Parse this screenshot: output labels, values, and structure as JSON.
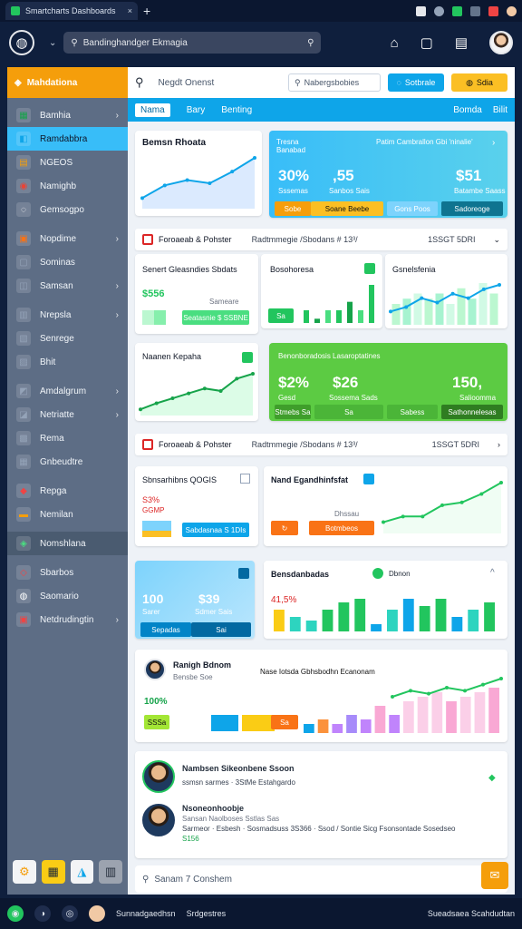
{
  "browser": {
    "tab_title": "Smartcharts Dashboards",
    "tab_close": "×",
    "new_tab": "+"
  },
  "app": {
    "logo_glyph": "◍",
    "search_placeholder": "Bandinghandger Ekmagia",
    "top_icons": [
      "home-icon",
      "square-icon",
      "calendar-icon"
    ]
  },
  "sidebar": {
    "header": "Mahdationa",
    "items": [
      {
        "label": "Bamhia",
        "icon": "▦",
        "color": "#16a34a",
        "chevron": true
      },
      {
        "label": "Ramdabbra",
        "icon": "◧",
        "color": "#0ea5e9",
        "active": true
      },
      {
        "label": "NGEOS",
        "icon": "▤",
        "color": "#f59e0b"
      },
      {
        "label": "Namighb",
        "icon": "◉",
        "color": "#ea4335"
      },
      {
        "label": "Gemsogpo",
        "icon": "◌",
        "color": "#ffffff"
      },
      {
        "label": "Nopdime",
        "icon": "▣",
        "color": "#f97316",
        "chevron": true
      },
      {
        "label": "Sominas",
        "icon": "▢",
        "color": "#94a3b8"
      },
      {
        "label": "Samsan",
        "icon": "◫",
        "color": "#94a3b8",
        "chevron": true
      },
      {
        "label": "Nrepsla",
        "icon": "▥",
        "color": "#94a3b8",
        "chevron": true
      },
      {
        "label": "Senrege",
        "icon": "▧",
        "color": "#94a3b8"
      },
      {
        "label": "Bhit",
        "icon": "▨",
        "color": "#94a3b8"
      },
      {
        "label": "Amdalgrum",
        "icon": "◩",
        "color": "#94a3b8",
        "chevron": true
      },
      {
        "label": "Netriatte",
        "icon": "◪",
        "color": "#94a3b8",
        "chevron": true
      },
      {
        "label": "Rema",
        "icon": "▩",
        "color": "#94a3b8"
      },
      {
        "label": "Gnbeudtre",
        "icon": "▦",
        "color": "#94a3b8"
      },
      {
        "label": "Repga",
        "icon": "◆",
        "color": "#ef4444"
      },
      {
        "label": "Nemilan",
        "icon": "▬",
        "color": "#f59e0b"
      },
      {
        "label": "Nomshlana",
        "icon": "◈",
        "color": "#4ade80",
        "active2": true
      },
      {
        "label": "Sbarbos",
        "icon": "◇",
        "color": "#ef4444"
      },
      {
        "label": "Saomario",
        "icon": "◍",
        "color": "#ffffff"
      },
      {
        "label": "Netdrudingtin",
        "icon": "▣",
        "color": "#ef4444",
        "chevron": true
      }
    ],
    "bottom_buttons": [
      "⚙",
      "▦",
      "◮",
      "▥"
    ]
  },
  "main": {
    "topbar_label": "Negdt Onenst",
    "search_placeholder": "Nabergsbobies",
    "btn_blue": "Sotbrale",
    "btn_orange": "Sdia",
    "tabs": [
      "Nama",
      "Bary",
      "Benting"
    ],
    "tabs_right": [
      "Bomda",
      "Bilit"
    ]
  },
  "cards": {
    "revenue": {
      "title": "Bemsn Rhoata"
    },
    "blue_stats": {
      "label_left": "Tresna Banabad",
      "label_right": "Patim Cambrallon Gbi 'ninalie'",
      "v1": "30%",
      "v1_sub": "Sssemas",
      "v2": ",55",
      "v2_sub": "Sanbos  Sais",
      "v3": "$51",
      "v3_sub": "Batambe Saass",
      "pill1": "Sobe",
      "pill2": "Soane Beebe",
      "pill3": "Gons Poos",
      "pill4": "Sadoreoge"
    },
    "section1": {
      "title": "Foroaeab & Pohster",
      "mid": "Radtmmegie /Sbodans # 13³/",
      "date": "1SSGT 5DRI"
    },
    "sales": {
      "title": "Senert Gleasndies Sbdats",
      "value": "$556",
      "sub": "Sameare",
      "button": "Seatasnie $ SSBNE"
    },
    "goodhousa": {
      "title": "Bosohoresa",
      "button": "Sa"
    },
    "generalia": {
      "title": "Gsnelsfenia"
    },
    "kanaka": {
      "title": "Naanen Kepaha"
    },
    "green_stats": {
      "title": "Benonboradosis  Lasaroptatines",
      "v1": "$2%",
      "v1_sub": "Gesd",
      "v2": "$26",
      "v2_sub": "Sossema Sads",
      "v3": "150,",
      "v3_sub": "Salioomma",
      "pill1": "Stmebs Sa",
      "pill2": "Sa",
      "pill3": "Sabess",
      "pill4": "Sathonnelesas"
    },
    "section2": {
      "title": "Foroaeab & Pohster",
      "mid": "Radtmmegie /Sbodans # 13³/",
      "date": "1SSGT 5DRI"
    },
    "conv": {
      "title": "Sbnsarhibns QOGIS",
      "value": "S3%",
      "sub": "GGMP",
      "button": "Sabdasnaa S 1DIs"
    },
    "engagement": {
      "title": "Nand Egandhinfsfat",
      "sub": "Dhssau",
      "button1": " ",
      "button2": "Botmbeos"
    },
    "lightblue": {
      "v1": "100",
      "v1_sub": "Sarer",
      "v2": "$39",
      "v2_sub": "Sdmer Sais",
      "pill1": "Sepadas",
      "pill2": "Sai"
    },
    "breakdown": {
      "title": "Bensdanbadas",
      "badge": "Dbnon",
      "value": "41,5%"
    },
    "team": {
      "title": "Ranigh Bdnom",
      "sub": "Bensbe Soe",
      "right_title": "Nase Iotsda Gbhsbodhn Ecanonam",
      "value": "100%",
      "pill1": "SSSa",
      "pill2": "Sa"
    },
    "people": [
      {
        "name": "Nambsen Sikeonbene Ssoon",
        "meta": "ssmsn sarmes  · 3StMe  Estahgardo"
      },
      {
        "name": "Nsoneonhoobje",
        "meta": "Sansan Naolboses Sstlas Sas",
        "meta2": "Sarmeor  · Esbesh  ·  Sosmadsuss  3S366 · Ssod / Sontie  Sicg  Fsonsontade  Sosedseo",
        "meta3": "S156"
      }
    ],
    "bottom_search": "Sanam 7 Conshem"
  },
  "taskbar": {
    "items": [
      "Sunnadgaedhsn",
      "Srdgestres"
    ],
    "right": "Sueadsaea Scahdudtan"
  },
  "chart_data": [
    {
      "type": "area",
      "title": "Bemsn Rhoata",
      "values": [
        10,
        22,
        27,
        24,
        35,
        48
      ]
    },
    {
      "type": "bar",
      "title": "Bosohoresa",
      "values": [
        3,
        1,
        3,
        3,
        5,
        3,
        9
      ]
    },
    {
      "type": "bar",
      "title": "Gsnelsfenia",
      "values": [
        4,
        5,
        6,
        5,
        6,
        4,
        7,
        5,
        8,
        6
      ],
      "line": [
        3,
        4,
        6,
        5,
        7,
        6,
        8,
        9
      ]
    },
    {
      "type": "area",
      "title": "Naanen Kepaha",
      "values": [
        5,
        10,
        14,
        18,
        22,
        20,
        30,
        34
      ]
    },
    {
      "type": "line",
      "title": "Nand Egandhinfsfat",
      "values": [
        8,
        12,
        12,
        20,
        22,
        28,
        36
      ]
    },
    {
      "type": "bar",
      "title": "Bensdanbadas",
      "series": [
        {
          "name": "s1",
          "values": [
            6,
            4,
            3,
            6,
            8,
            9,
            2,
            6,
            9,
            7,
            9,
            4,
            6,
            8
          ]
        }
      ]
    },
    {
      "type": "bar",
      "title": "Nase Iotsda Gbhsbodhn Ecanonam",
      "series": [
        {
          "name": "bars",
          "values": [
            2,
            3,
            2,
            4,
            3,
            6,
            4,
            7,
            8,
            9,
            7,
            8,
            9,
            10
          ]
        },
        {
          "name": "line",
          "values": [
            6,
            8,
            7,
            9,
            8,
            10,
            12
          ]
        }
      ]
    }
  ]
}
